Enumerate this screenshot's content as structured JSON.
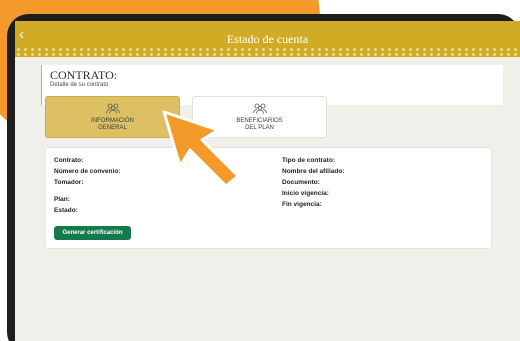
{
  "header": {
    "title": "Estado de cuenta",
    "back_icon": "chevron-left-icon",
    "color": "#d2ab25"
  },
  "contrato": {
    "title": "CONTRATO:",
    "subtitle": "Detalle de su contrato"
  },
  "tabs": [
    {
      "label": "INFORMACIÓN\nGENERAL",
      "icon": "people-group-icon",
      "active": true
    },
    {
      "label": "BENEFICIARIOS\nDEL PLAN",
      "icon": "people-group-icon",
      "active": false
    }
  ],
  "details": {
    "left": [
      "Contrato:",
      "Número de convenio:",
      "Tomador:",
      "Plan:",
      "Estado:"
    ],
    "right": [
      "Tipo de contrato:",
      "Nombre del afiliado:",
      "Documento:",
      "Inicio vigencia:",
      "Fin vigencia:"
    ]
  },
  "actions": {
    "generate_label": "Generar certificación",
    "button_color": "#137a4e"
  },
  "decor": {
    "accent_orange": "#f39a2a",
    "pointer": "arrow-pointer-icon"
  }
}
